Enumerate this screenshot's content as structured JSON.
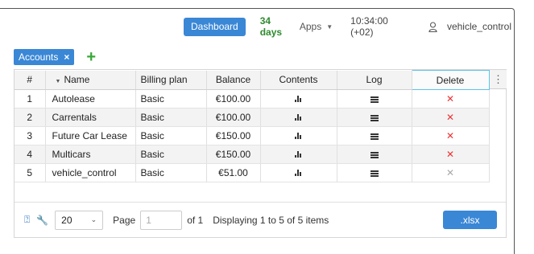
{
  "topbar": {
    "dashboard_label": "Dashboard",
    "days_label": "34 days",
    "apps_label": "Apps",
    "time_label": "10:34:00 (+02)",
    "user_label": "vehicle_control"
  },
  "tabs": {
    "accounts_label": "Accounts",
    "close_glyph": "×",
    "add_glyph": "+"
  },
  "table": {
    "columns": {
      "num": "#",
      "name": "Name",
      "plan": "Billing plan",
      "balance": "Balance",
      "contents": "Contents",
      "log": "Log",
      "delete": "Delete"
    },
    "menu_glyph": "⋮",
    "rows": [
      {
        "num": "1",
        "name": "Autolease",
        "plan": "Basic",
        "balance": "€100.00",
        "deletable": true
      },
      {
        "num": "2",
        "name": "Carrentals",
        "plan": "Basic",
        "balance": "€100.00",
        "deletable": true
      },
      {
        "num": "3",
        "name": "Future Car Lease",
        "plan": "Basic",
        "balance": "€150.00",
        "deletable": true
      },
      {
        "num": "4",
        "name": "Multicars",
        "plan": "Basic",
        "balance": "€150.00",
        "deletable": true
      },
      {
        "num": "5",
        "name": "vehicle_control",
        "plan": "Basic",
        "balance": "€51.00",
        "deletable": false
      }
    ],
    "delete_glyph": "✕"
  },
  "footer": {
    "page_size": "20",
    "page_label": "Page",
    "page_value": "1",
    "of_label": "of 1",
    "info_label": "Displaying 1 to 5 of 5 items",
    "export_label": ".xlsx"
  },
  "colors": {
    "accent": "#3a87d6",
    "days_green": "#2e8b2e",
    "add_green": "#35a835",
    "delete_red": "#ee3333",
    "delete_disabled": "#aaaaaa",
    "header_focus": "#5dc3e8"
  },
  "icons": {
    "user": "user-icon",
    "contents": "bar-chart-icon",
    "log": "list-icon",
    "help": "help-icon",
    "settings": "wrench-icon"
  }
}
